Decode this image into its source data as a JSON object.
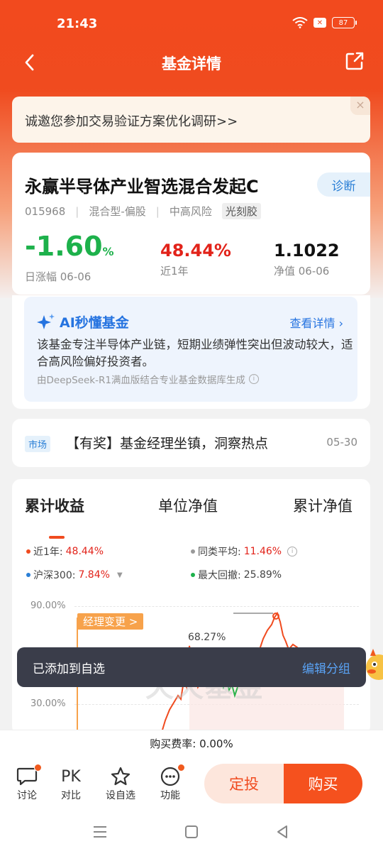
{
  "status_bar": {
    "time": "21:43",
    "battery": "87",
    "notification_x": "✕"
  },
  "nav": {
    "title": "基金详情"
  },
  "banner": {
    "text": "诚邀您参加交易验证方案优化调研>>",
    "close": "×"
  },
  "fund": {
    "name": "永赢半导体产业智选混合发起C",
    "diagnose_label": "诊断",
    "code": "015968",
    "type": "混合型-偏股",
    "risk": "中高风险",
    "theme_tag": "光刻胶",
    "daily_change": "-1.60",
    "daily_change_unit": "%",
    "daily_change_label": "日涨幅 06-06",
    "year_return": "48.44%",
    "year_return_label": "近1年",
    "nav_value": "1.1022",
    "nav_label": "净值 06-06"
  },
  "ai": {
    "title": "AI秒懂基金",
    "more": "查看详情 ›",
    "text": "该基金专注半导体产业链，短期业绩弹性突出但波动较大，适合高风险偏好投资者。",
    "source": "由DeepSeek-R1满血版结合专业基金数据库生成",
    "info_icon": "i"
  },
  "news": {
    "tag": "市场",
    "text": "【有奖】基金经理坐镇，洞察热点",
    "date": "05-30"
  },
  "chart_section": {
    "tabs": [
      "累计收益",
      "单位净值",
      "累计净值"
    ],
    "legend": {
      "year_label": "近1年:",
      "year_value": "48.44%",
      "peer_label": "同类平均:",
      "peer_value": "11.46%",
      "hs300_label": "沪深300:",
      "hs300_value": "7.84%",
      "drawdown_label": "最大回撤:",
      "drawdown_value": "25.89%"
    },
    "y_labels": [
      "90.00%",
      "30.00%"
    ],
    "manager_tag": "经理变更 >",
    "peak_label": "68.27%",
    "watermark": "天天基金"
  },
  "toast": {
    "text": "已添加到自选",
    "action": "编辑分组"
  },
  "fee": {
    "text": "购买费率: 0.00%"
  },
  "bottom_bar": {
    "discuss": "讨论",
    "pk_icon": "PK",
    "compare": "对比",
    "watch": "设自选",
    "function": "功能",
    "dingtou": "定投",
    "buy": "购买"
  },
  "colors": {
    "brand": "#f04b1f",
    "up": "#e2231a",
    "down": "#1db14b",
    "link": "#2573e0"
  }
}
